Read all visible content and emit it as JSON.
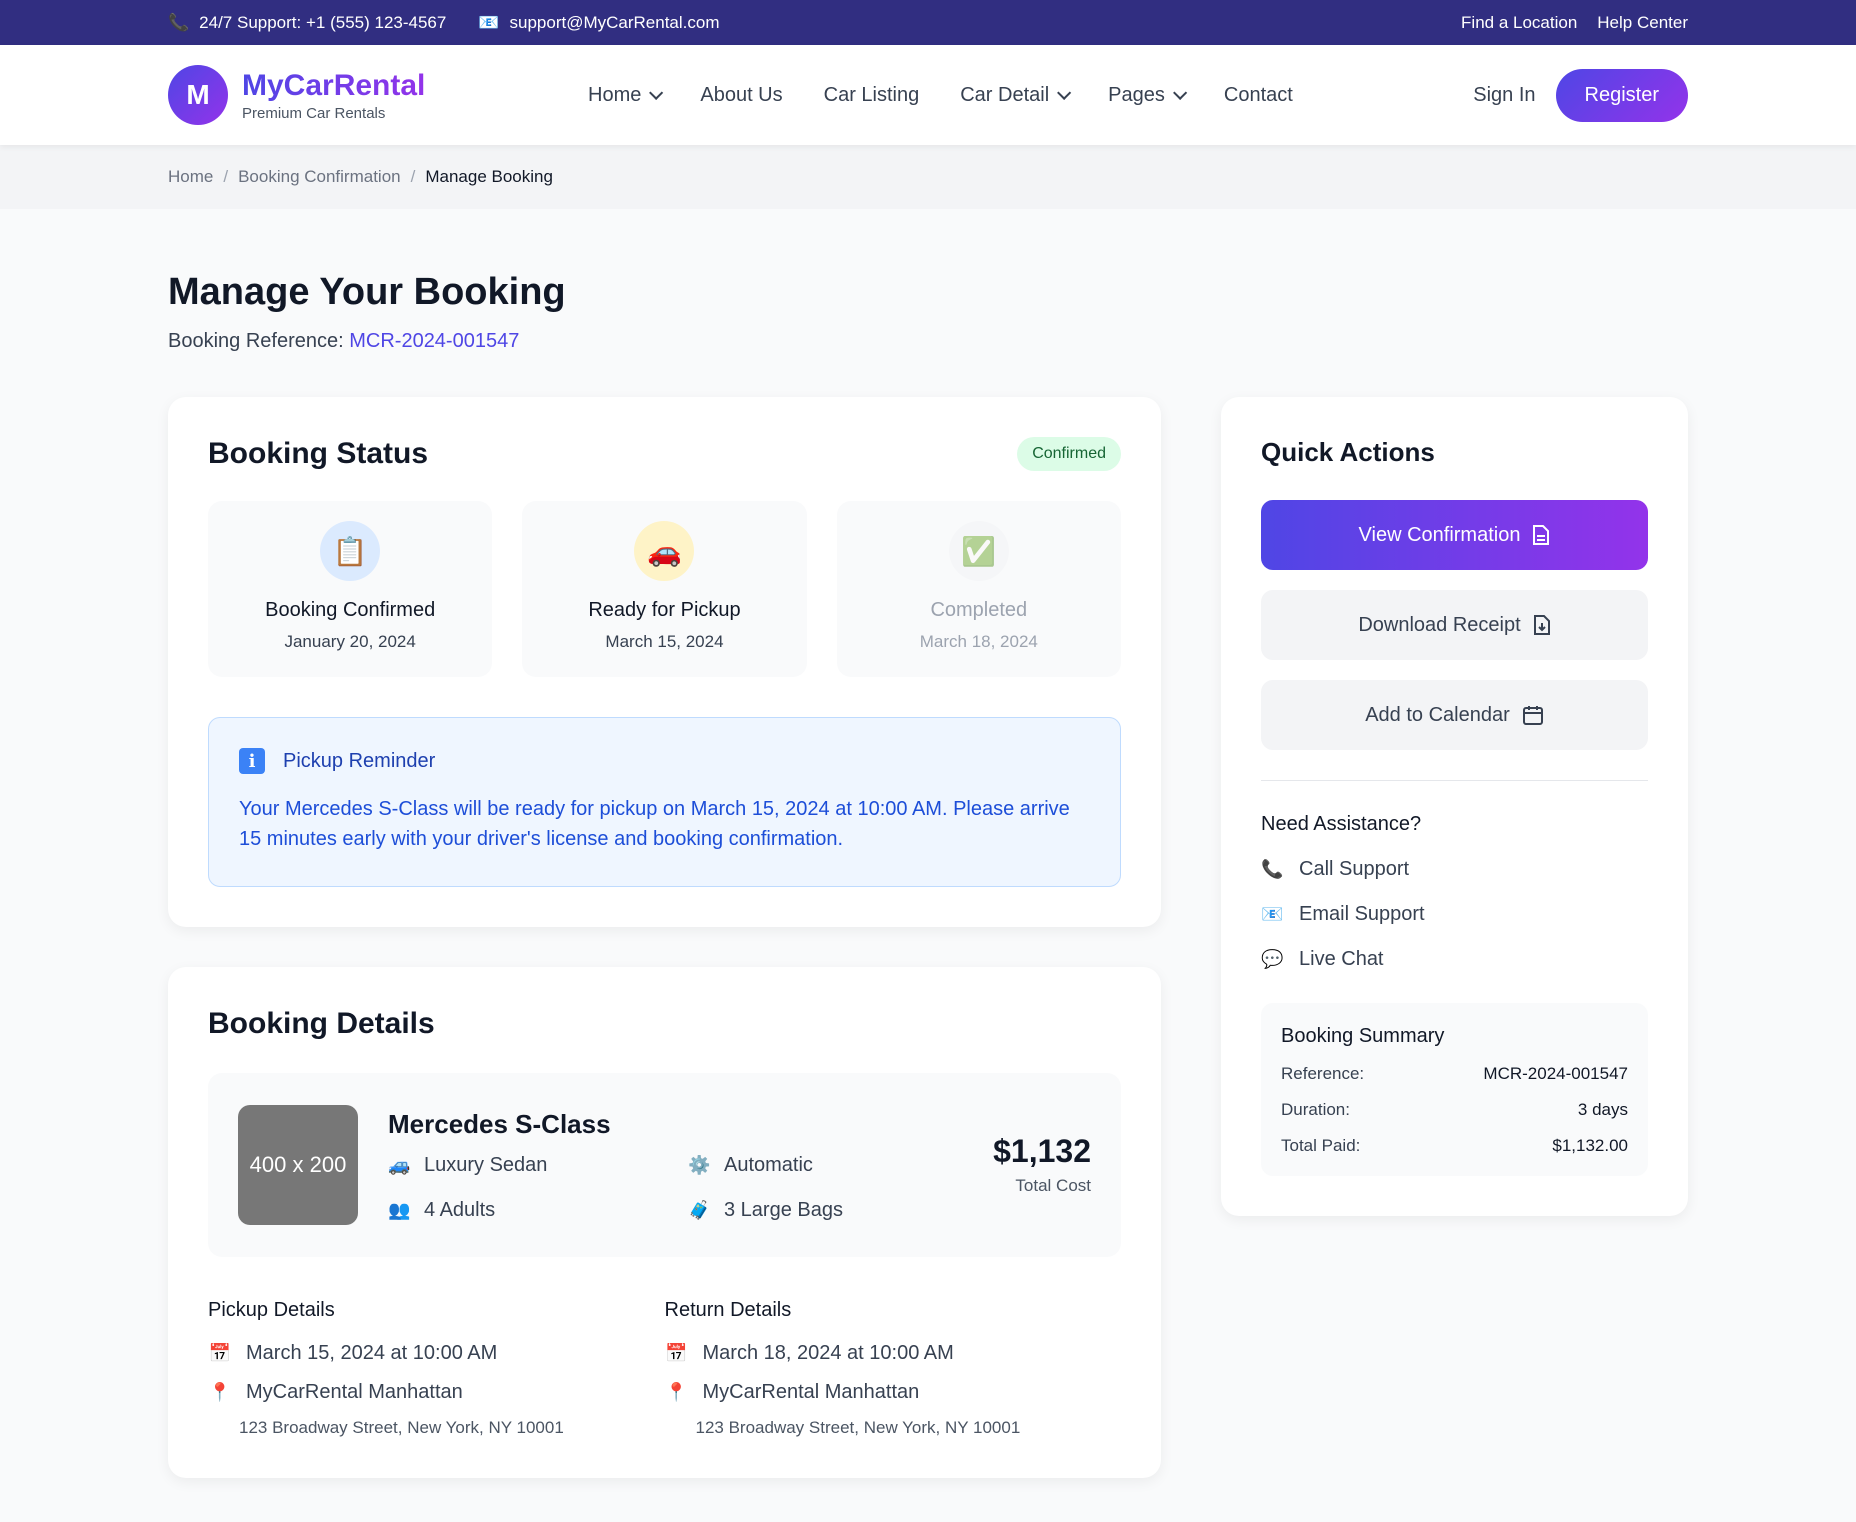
{
  "topbar": {
    "phone_icon": "📞",
    "phone": "24/7 Support: +1 (555) 123-4567",
    "email_icon": "📧",
    "email": "support@MyCarRental.com",
    "links": [
      "Find a Location",
      "Help Center"
    ]
  },
  "header": {
    "logo_letter": "M",
    "brand": "MyCarRental",
    "tagline": "Premium Car Rentals",
    "nav": [
      "Home",
      "About Us",
      "Car Listing",
      "Car Detail",
      "Pages",
      "Contact"
    ],
    "sign_in": "Sign In",
    "register": "Register"
  },
  "breadcrumb": [
    "Home",
    "Booking Confirmation",
    "Manage Booking"
  ],
  "breadcrumb_sep": "/",
  "page": {
    "title": "Manage Your Booking",
    "ref_label": "Booking Reference:",
    "ref_value": "MCR-2024-001547"
  },
  "status": {
    "heading": "Booking Status",
    "badge": "Confirmed",
    "steps": [
      {
        "icon": "📋",
        "title": "Booking Confirmed",
        "date": "January 20, 2024"
      },
      {
        "icon": "🚗",
        "title": "Ready for Pickup",
        "date": "March 15, 2024"
      },
      {
        "icon": "✅",
        "title": "Completed",
        "date": "March 18, 2024"
      }
    ],
    "reminder_icon": "i",
    "reminder_title": "Pickup Reminder",
    "reminder_text": "Your Mercedes S-Class will be ready for pickup on March 15, 2024 at 10:00 AM. Please arrive 15 minutes early with your driver's license and booking confirmation."
  },
  "details": {
    "heading": "Booking Details",
    "image_placeholder": "400 x 200",
    "car_name": "Mercedes S-Class",
    "specs": [
      {
        "icon": "🚙",
        "text": "Luxury Sedan"
      },
      {
        "icon": "⚙️",
        "text": "Automatic"
      },
      {
        "icon": "👥",
        "text": "4 Adults"
      },
      {
        "icon": "🧳",
        "text": "3 Large Bags"
      }
    ],
    "price": "$1,132",
    "price_label": "Total Cost",
    "pickup": {
      "heading": "Pickup Details",
      "datetime": "March 15, 2024 at 10:00 AM",
      "location": "MyCarRental Manhattan",
      "address": "123 Broadway Street, New York, NY 10001"
    },
    "return": {
      "heading": "Return Details",
      "datetime": "March 18, 2024 at 10:00 AM",
      "location": "MyCarRental Manhattan",
      "address": "123 Broadway Street, New York, NY 10001"
    },
    "calendar_icon": "📅",
    "pin_icon": "📍"
  },
  "quick_actions": {
    "heading": "Quick Actions",
    "view_confirmation": "View Confirmation",
    "download_receipt": "Download Receipt",
    "add_to_calendar": "Add to Calendar",
    "assist_heading": "Need Assistance?",
    "assist": [
      {
        "icon": "📞",
        "label": "Call Support"
      },
      {
        "icon": "📧",
        "label": "Email Support"
      },
      {
        "icon": "💬",
        "label": "Live Chat"
      }
    ],
    "summary": {
      "heading": "Booking Summary",
      "rows": [
        {
          "label": "Reference:",
          "value": "MCR-2024-001547"
        },
        {
          "label": "Duration:",
          "value": "3 days"
        },
        {
          "label": "Total Paid:",
          "value": "$1,132.00"
        }
      ]
    }
  },
  "colors": {
    "topbar": "#312e81",
    "primary": "#4f46e5",
    "accent": "#9333ea",
    "success_bg": "#dcfce7",
    "info_bg": "#eff6ff"
  }
}
